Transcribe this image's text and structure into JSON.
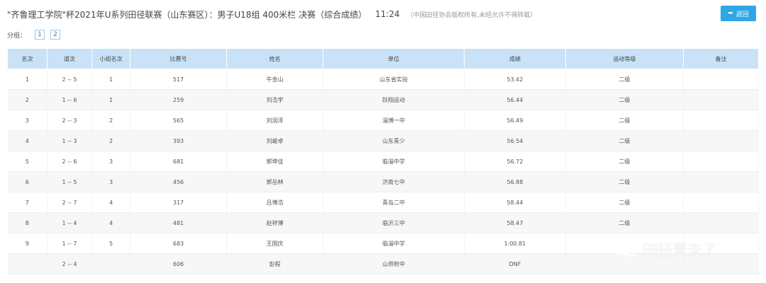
{
  "header": {
    "title": "\"齐鲁理工学院\"杯2021年U系列田径联赛（山东赛区）：男子U18组 400米栏 决赛（综合成绩）",
    "time": "11:24",
    "copyright": "（中国田径协会版权所有,未经允许不得转载）"
  },
  "back_button": {
    "label": "返回",
    "icon": "share-arrow-icon"
  },
  "groups": {
    "label": "分组：",
    "items": [
      "1",
      "2"
    ]
  },
  "table": {
    "columns": [
      "名次",
      "道次",
      "小组名次",
      "比赛号",
      "姓名",
      "单位",
      "成绩",
      "运动等级",
      "备注"
    ],
    "rows": [
      [
        "1",
        "2 -- 5",
        "1",
        "517",
        "牛金山",
        "山东省实验",
        "53.42",
        "二级",
        ""
      ],
      [
        "2",
        "1 -- 6",
        "1",
        "259",
        "刘浩宇",
        "跃翔运动",
        "56.44",
        "二级",
        ""
      ],
      [
        "3",
        "2 -- 3",
        "2",
        "565",
        "刘润泽",
        "淄博一中",
        "56.49",
        "二级",
        ""
      ],
      [
        "4",
        "1 -- 3",
        "2",
        "393",
        "刘峻卓",
        "山东青少",
        "56.54",
        "二级",
        ""
      ],
      [
        "5",
        "2 -- 6",
        "3",
        "681",
        "郭坤佳",
        "临淄中学",
        "56.72",
        "二级",
        ""
      ],
      [
        "6",
        "1 -- 5",
        "3",
        "456",
        "郭岳林",
        "济南七中",
        "56.88",
        "二级",
        ""
      ],
      [
        "7",
        "2 -- 7",
        "4",
        "317",
        "吕博浩",
        "青岛二中",
        "58.44",
        "二级",
        ""
      ],
      [
        "8",
        "1 -- 4",
        "4",
        "481",
        "赵祥博",
        "临沂三中",
        "58.47",
        "二级",
        ""
      ],
      [
        "9",
        "1 -- 7",
        "5",
        "683",
        "王国庆",
        "临淄中学",
        "1:00.81",
        "",
        ""
      ],
      [
        "",
        "2 -- 4",
        "",
        "606",
        "彭程",
        "山师附中",
        "DNF",
        "",
        ""
      ]
    ]
  },
  "watermark": {
    "text": "田径青未了",
    "icon": "wechat-icon"
  },
  "colors": {
    "accent": "#2fa6e6",
    "header_bg": "#c9e2f7",
    "row_alt": "#f7f7f7"
  }
}
